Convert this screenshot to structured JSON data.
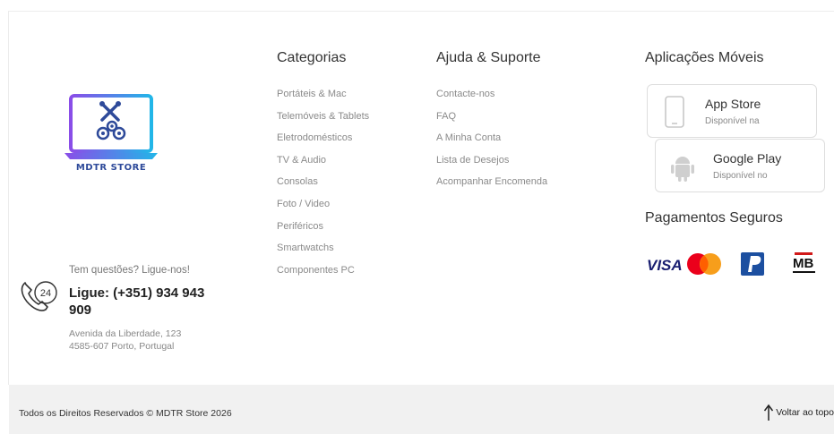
{
  "brand": {
    "logo_text": "MDTR STORE"
  },
  "contact": {
    "question": "Tem questões? Ligue-nos!",
    "phone": "Ligue: (+351) 934 943 909",
    "icon_label": "24",
    "address_line1": "Avenida da Liberdade, 123",
    "address_line2": "4585-607 Porto, Portugal"
  },
  "categories": {
    "title": "Categorias",
    "items": [
      "Portáteis & Mac",
      "Telemóveis & Tablets",
      "Eletrodomésticos",
      "TV & Audio",
      "Consolas",
      "Foto / Video",
      "Periféricos",
      "Smartwatchs",
      "Componentes PC"
    ]
  },
  "support": {
    "title": "Ajuda & Suporte",
    "items": [
      "Contacte-nos",
      "FAQ",
      "A Minha Conta",
      "Lista de Desejos",
      "Acompanhar Encomenda"
    ]
  },
  "apps": {
    "title": "Aplicações Móveis",
    "app_store": {
      "name": "App Store",
      "sub": "Disponível na"
    },
    "google_play": {
      "name": "Google Play",
      "sub": "Disponível no"
    }
  },
  "payments": {
    "title": "Pagamentos Seguros",
    "methods": [
      "VISA",
      "Mastercard",
      "PayPal",
      "MB"
    ],
    "visa_text": "VISA",
    "mb_text": "MB"
  },
  "footer": {
    "copyright": "Todos os Direitos Reservados © MDTR Store 2026",
    "back_to_top": "Voltar ao topo"
  },
  "colors": {
    "logo_gradient_start": "#8a4de8",
    "logo_gradient_end": "#22b6e8",
    "visa_blue": "#1a1f71",
    "mastercard_red": "#eb001b",
    "mastercard_orange": "#f79e1b",
    "paypal_blue": "#003087",
    "bottom_bar": "#f1f1f1"
  }
}
